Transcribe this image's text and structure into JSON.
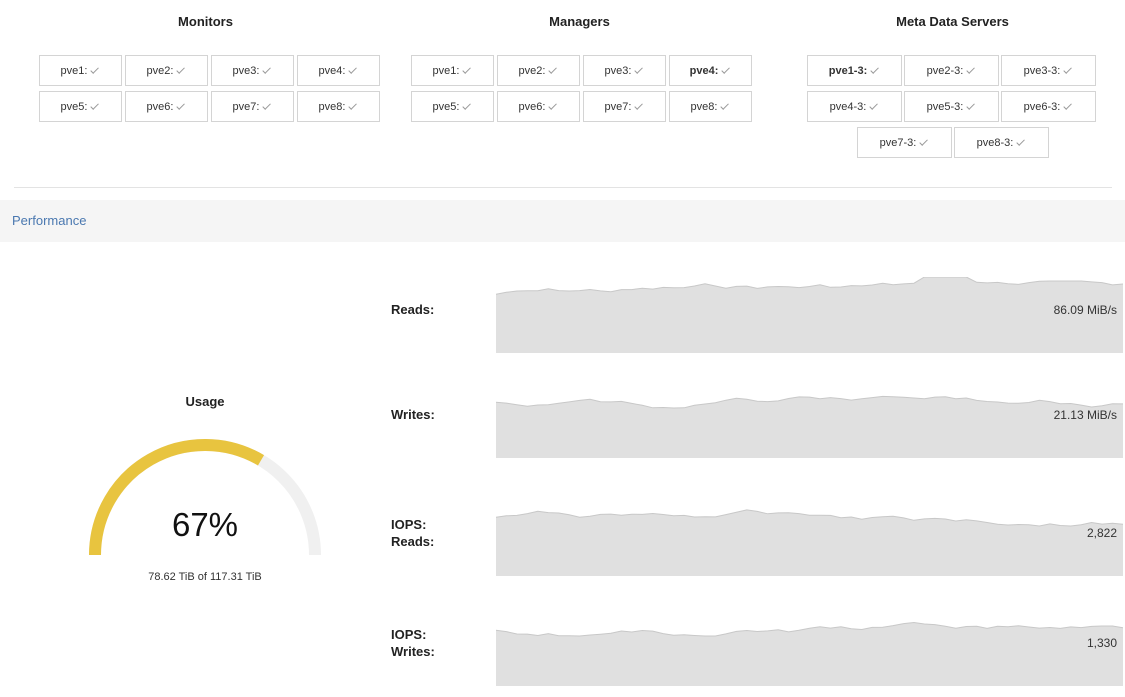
{
  "services": {
    "monitors": {
      "title": "Monitors",
      "nodes": [
        "pve1:",
        "pve2:",
        "pve3:",
        "pve4:",
        "pve5:",
        "pve6:",
        "pve7:",
        "pve8:"
      ]
    },
    "managers": {
      "title": "Managers",
      "nodes": [
        "pve1:",
        "pve2:",
        "pve3:",
        "pve4:",
        "pve5:",
        "pve6:",
        "pve7:",
        "pve8:"
      ],
      "bold_node": "pve4:"
    },
    "mds": {
      "title": "Meta Data Servers",
      "nodes": [
        "pve1-3:",
        "pve2-3:",
        "pve3-3:",
        "pve4-3:",
        "pve5-3:",
        "pve6-3:",
        "pve7-3:",
        "pve8-3:"
      ],
      "bold_node": "pve1-3:"
    },
    "status_icon": "check-icon"
  },
  "performance": {
    "title": "Performance"
  },
  "usage": {
    "title": "Usage",
    "percent_label": "67%",
    "fraction": 0.67,
    "detail": "78.62 TiB of 117.31 TiB",
    "colors": {
      "fill": "#e8c43f",
      "track": "#f0f0f0"
    }
  },
  "metrics": [
    {
      "label": "Reads:",
      "value": "86.09 MiB/s"
    },
    {
      "label": "Writes:",
      "value": "21.13 MiB/s"
    },
    {
      "label": "IOPS:\nReads:",
      "value": "2,822"
    },
    {
      "label": "IOPS:\nWrites:",
      "value": "1,330"
    }
  ],
  "colors": {
    "spark_fill": "#e0e0e0",
    "spark_stroke": "#c8c8c8",
    "perf_title": "#4a78b0"
  }
}
